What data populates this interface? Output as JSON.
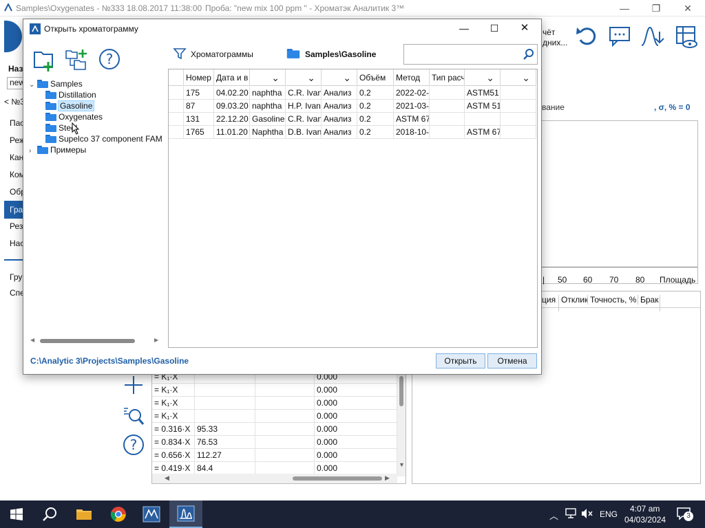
{
  "main_window": {
    "title_path": "Samples\\Oxygenates - №333 18.08.2017 11:38:00",
    "title_sample": "Проба: \"new mix 100 ppm \" - Хроматэк Аналитик 3™",
    "left_partial": [
      "Наз",
      "new",
      "< №3",
      "Пас",
      "Реж",
      "Кан",
      "Ком",
      "Обр",
      "Гра",
      "Рез",
      "Нас",
      "Гру",
      "Спе"
    ],
    "toolbar_partial": [
      "чёт",
      "дних..."
    ],
    "right_header": "вание",
    "sigma_label": ", σ, % = 0",
    "axis_ticks": [
      "50",
      "60",
      "70",
      "80",
      "Площадь"
    ],
    "table_headers": [
      "ция",
      "Отклик",
      "Точность, %",
      "Брак"
    ],
    "calib_rows": [
      {
        "formula": "= K₁·X",
        "val": "",
        "acc": "0.000"
      },
      {
        "formula": "= K₁·X",
        "val": "",
        "acc": "0.000"
      },
      {
        "formula": "= K₁·X",
        "val": "",
        "acc": "0.000"
      },
      {
        "formula": "= K₁·X",
        "val": "",
        "acc": "0.000"
      },
      {
        "formula": "= 0.316·X",
        "val": "95.33",
        "acc": "0.000"
      },
      {
        "formula": "= 0.834·X",
        "val": "76.53",
        "acc": "0.000"
      },
      {
        "formula": "= 0.656·X",
        "val": "112.27",
        "acc": "0.000"
      },
      {
        "formula": "= 0.419·X",
        "val": "84.4",
        "acc": "0.000"
      }
    ]
  },
  "dialog": {
    "title": "Открыть хроматограмму",
    "filter_label": "Хроматограммы",
    "current_folder": "Samples\\Gasoline",
    "search_placeholder": "",
    "tree": [
      {
        "label": "Samples",
        "level": 0,
        "expanded": true
      },
      {
        "label": "Distillation",
        "level": 1
      },
      {
        "label": "Gasoline",
        "level": 1,
        "selected": true
      },
      {
        "label": "Oxygenates",
        "level": 1
      },
      {
        "label": "Steel",
        "level": 1
      },
      {
        "label": "Supelco 37 component FAM",
        "level": 1
      },
      {
        "label": "Примеры",
        "level": 0,
        "expanded": false
      }
    ],
    "columns": [
      "",
      "Номер",
      "Дата и в",
      "",
      "",
      "",
      "Объём",
      "Метод",
      "Тип расч",
      "",
      ""
    ],
    "rows": [
      [
        "175",
        "04.02.20",
        "naphtha",
        "C.R. Ivan",
        "Анализ",
        "0.2",
        "2022-02-",
        "",
        "ASTM51",
        ""
      ],
      [
        "87",
        "09.03.20",
        "naphtha",
        "H.P. Ivan",
        "Анализ",
        "0.2",
        "2021-03-",
        "",
        "ASTM 51",
        ""
      ],
      [
        "131",
        "22.12.20",
        "Gasoline",
        "C.R. Ivan",
        "Анализ",
        "0.2",
        "ASTM 67",
        "",
        "",
        ""
      ],
      [
        "1765",
        "11.01.20",
        "Naphtha",
        "D.B. Ivan",
        "Анализ",
        "0.2",
        "2018-10-",
        "",
        "ASTM 67",
        ""
      ]
    ],
    "path": "C:\\Analytic 3\\Projects\\Samples\\Gasoline",
    "open_label": "Открыть",
    "cancel_label": "Отмена"
  },
  "taskbar": {
    "lang": "ENG",
    "time": "4:07 am",
    "date": "04/03/2024",
    "notifications": "3"
  },
  "colors": {
    "accent": "#1f5fa8",
    "folder": "#2c86e6",
    "selection": "#cce8ff",
    "taskbar": "#1b2236"
  }
}
